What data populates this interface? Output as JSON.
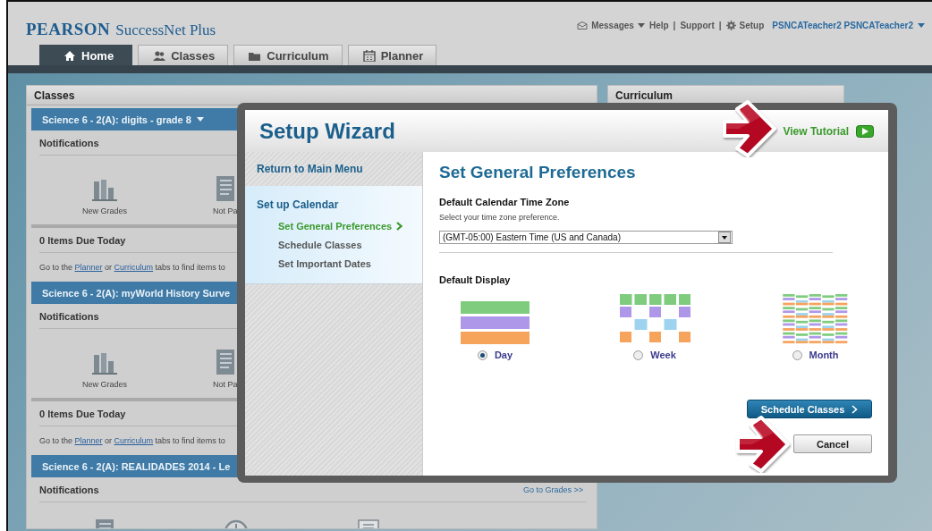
{
  "header": {
    "brand": "PEARSON",
    "product": "SuccessNet Plus",
    "links": [
      {
        "label": "Messages",
        "kind": "mail"
      },
      {
        "label": "Help",
        "kind": "plain"
      },
      {
        "label": "|",
        "kind": "separator"
      },
      {
        "label": "Support",
        "kind": "plain"
      },
      {
        "label": "|",
        "kind": "separator"
      },
      {
        "label": "Setup",
        "kind": "gear"
      }
    ],
    "user": "PSNCATeacher2 PSNCATeacher2"
  },
  "tabs": [
    {
      "label": "Home",
      "selected": true
    },
    {
      "label": "Classes",
      "selected": false
    },
    {
      "label": "Curriculum",
      "selected": false
    },
    {
      "label": "Planner",
      "selected": false
    }
  ],
  "classes_panel": {
    "title": "Classes",
    "sections": [
      {
        "title": "Science 6 - 2(A): digits - grade 8",
        "caret": true,
        "notifications": "Notifications",
        "items": [
          {
            "label": "New Grades",
            "kind": "bars"
          },
          {
            "label": "Not Pa",
            "kind": "list"
          }
        ],
        "due": "0 Items Due Today",
        "hint": [
          {
            "text": "Go to the "
          },
          {
            "text": "Planner",
            "link": true
          },
          {
            "text": " or "
          },
          {
            "text": "Curriculum",
            "link": true
          },
          {
            "text": " tabs to find items to"
          }
        ]
      },
      {
        "title": "Science 6 - 2(A): myWorld History Surve",
        "caret": false,
        "notifications": "Notifications",
        "items": [
          {
            "label": "New Grades",
            "kind": "bars"
          },
          {
            "label": "Not Pa",
            "kind": "list"
          }
        ],
        "due": "0 Items Due Today",
        "hint": [
          {
            "text": "Go to the "
          },
          {
            "text": "Planner",
            "link": true
          },
          {
            "text": " or "
          },
          {
            "text": "Curriculum",
            "link": true
          },
          {
            "text": " tabs to find items to"
          }
        ]
      },
      {
        "title": "Science 6 - 2(A): REALIDADES 2014 - Le",
        "caret": false,
        "notifications": "Notifications",
        "grades_link": "Go to Grades >>",
        "items": [
          {
            "kind": "list"
          },
          {
            "kind": "clock"
          },
          {
            "kind": "doc"
          }
        ]
      }
    ]
  },
  "curriculum_panel": {
    "title": "Curriculum"
  },
  "wizard": {
    "title": "Setup Wizard",
    "tutorial": "View Tutorial",
    "nav": {
      "return": "Return to Main Menu",
      "group": "Set up Calendar",
      "steps": [
        {
          "label": "Set General Preferences",
          "selected": true
        },
        {
          "label": "Schedule Classes",
          "selected": false
        },
        {
          "label": "Set Important Dates",
          "selected": false
        }
      ]
    },
    "heading": "Set General Preferences",
    "timezone": {
      "label": "Default Calendar Time Zone",
      "hint": "Select your time zone preference.",
      "value": "(GMT-05:00) Eastern Time (US and Canada)"
    },
    "display": {
      "label": "Default Display",
      "options": [
        {
          "label": "Day",
          "kind": "day",
          "selected": true
        },
        {
          "label": "Week",
          "kind": "week",
          "selected": false
        },
        {
          "label": "Month",
          "kind": "month",
          "selected": false
        }
      ]
    },
    "next_button": "Schedule Classes",
    "cancel_button": "Cancel"
  }
}
